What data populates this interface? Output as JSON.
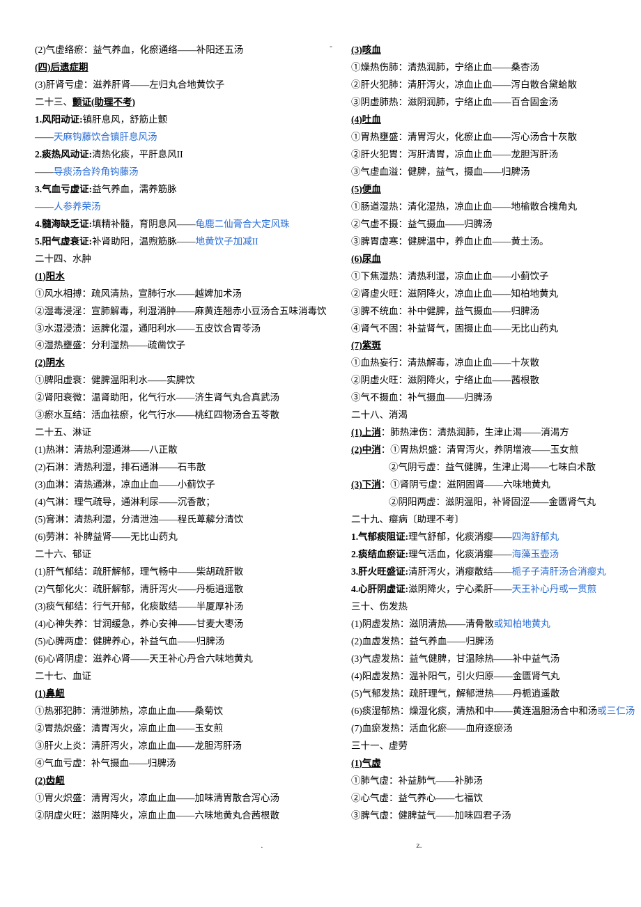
{
  "header_dash": "-",
  "footerL": ".",
  "footerR": "z.",
  "left": [
    [
      {
        "t": "(2)气虚络瘀：益气养血，化瘀通络——补阳还五汤"
      }
    ],
    [
      {
        "t": "(四)后遗症期",
        "cls": "b u"
      }
    ],
    [
      {
        "t": "(3)肝肾亏虚：滋养肝肾——左归丸合地黄饮子"
      }
    ],
    [
      {
        "t": "二十三、"
      },
      {
        "t": "颤证(助理不考)",
        "cls": "b u"
      }
    ],
    [
      {
        "t": "1.风阳动证:",
        "cls": "b"
      },
      {
        "t": "镇肝息风，舒筋止颤"
      }
    ],
    [
      {
        "t": "——"
      },
      {
        "t": "天麻钩藤饮合镇肝息风汤",
        "cls": "blue"
      }
    ],
    [
      {
        "t": "2.痰热风动证:",
        "cls": "b"
      },
      {
        "t": "清热化痰，平肝息风II"
      }
    ],
    [
      {
        "t": "——"
      },
      {
        "t": "导痰汤合羚角钩藤汤",
        "cls": "blue"
      }
    ],
    [
      {
        "t": "3.气血亏虚证:",
        "cls": "b"
      },
      {
        "t": "益气养血，濡养筋脉"
      }
    ],
    [
      {
        "t": "——"
      },
      {
        "t": "人参养荣汤",
        "cls": "blue"
      }
    ],
    [
      {
        "t": "4.髓海缺乏证:",
        "cls": "b"
      },
      {
        "t": "填精补髓，育阴息风——"
      },
      {
        "t": "龟鹿二仙膏合大定风珠",
        "cls": "blue"
      }
    ],
    [
      {
        "t": "5.阳气虚衰证:",
        "cls": "b"
      },
      {
        "t": "补肾助阳，温煦筋脉——"
      },
      {
        "t": "地黄饮子加减II",
        "cls": "blue"
      }
    ],
    [
      {
        "t": "二十四、水肿"
      }
    ],
    [
      {
        "t": "(1)阳水",
        "cls": "b u"
      }
    ],
    [
      {
        "t": "①风水相搏：疏风清热，宣肺行水——越婢加术汤"
      }
    ],
    [
      {
        "t": "②湿毒浸淫：宣肺解毒，利湿消肿——麻黄连翘赤小豆汤合五味消毒饮"
      }
    ],
    [
      {
        "t": "③水湿浸渍：运脾化湿，通阳利水——五皮饮合胃苓汤"
      }
    ],
    [
      {
        "t": "④湿热壅盛：分利湿热——疏凿饮子"
      }
    ],
    [
      {
        "t": "(2)阴水",
        "cls": "b u"
      }
    ],
    [
      {
        "t": "①脾阳虚衰：健脾温阳利水——实脾饮"
      }
    ],
    [
      {
        "t": "②肾阳衰微：温肾助阳，化气行水——济生肾气丸合真武汤"
      }
    ],
    [
      {
        "t": "③瘀水互结：活血祛瘀，化气行水——桃红四物汤合五苓散"
      }
    ],
    [
      {
        "t": "二十五、淋证"
      }
    ],
    [
      {
        "t": "(1)热淋：清热利湿通淋——八正散"
      }
    ],
    [
      {
        "t": "(2)石淋：清热利湿，排石通淋——石韦散"
      }
    ],
    [
      {
        "t": "(3)血淋：清热通淋，凉血止血——小蓟饮子"
      }
    ],
    [
      {
        "t": "(4)气淋：理气疏导，通淋利尿——沉香散；"
      }
    ],
    [
      {
        "t": "(5)膏淋：清热利湿，分清泄浊——程氏萆薢分清饮"
      }
    ],
    [
      {
        "t": "(6)劳淋：补脾益肾——无比山药丸"
      }
    ],
    [
      {
        "t": "二十六、郁证"
      }
    ],
    [
      {
        "t": "(1)肝气郁结：疏肝解郁，理气畅中——柴胡疏肝散"
      }
    ],
    [
      {
        "t": "(2)气郁化火：疏肝解郁，清肝泻火——丹栀逍遥散"
      }
    ],
    [
      {
        "t": "(3)痰气郁结：行气开郁，化痰散结——半厦厚补汤"
      }
    ],
    [
      {
        "t": "(4)心神失养：甘润缓急，养心安神——甘麦大枣汤"
      }
    ],
    [
      {
        "t": "(5)心脾两虚：健脾养心，补益气血——归脾汤"
      }
    ],
    [
      {
        "t": "(6)心肾阴虚：滋养心肾——天王补心丹合六味地黄丸"
      }
    ],
    [
      {
        "t": "二十七、血证"
      }
    ],
    [
      {
        "t": "(1)鼻衄",
        "cls": "b u"
      }
    ],
    [
      {
        "t": "①热邪犯肺：清泄肺热，凉血止血——桑菊饮"
      }
    ],
    [
      {
        "t": "②胃热炽盛：清胃泻火，凉血止血——玉女煎"
      }
    ],
    [
      {
        "t": "③肝火上炎：清肝泻火，凉血止血——龙胆泻肝汤"
      }
    ],
    [
      {
        "t": "④气血亏虚：补气摄血——归脾汤"
      }
    ],
    [
      {
        "t": "(2)齿衄",
        "cls": "b u"
      }
    ],
    [
      {
        "t": "①胃火炽盛：清胃泻火，凉血止血——加味清胃散合泻心汤"
      }
    ],
    [
      {
        "t": "②阴虚火旺：滋阴降火，凉血止血——六味地黄丸合茜根散"
      }
    ]
  ],
  "right": [
    [
      {
        "t": "(3)咳血",
        "cls": "b u"
      }
    ],
    [
      {
        "t": "①燥热伤肺：清热润肺，宁络止血——桑杏汤"
      }
    ],
    [
      {
        "t": "②肝火犯肺：清肝泻火，凉血止血——泻白散合黛蛤散"
      }
    ],
    [
      {
        "t": "③阴虚肺热：滋阴润肺，宁络止血——百合固金汤"
      }
    ],
    [
      {
        "t": "(4)吐血",
        "cls": "b u"
      }
    ],
    [
      {
        "t": "①胃热壅盛：清胃泻火，化瘀止血——泻心汤合十灰散"
      }
    ],
    [
      {
        "t": "②肝火犯胃：泻肝清胃，凉血止血——龙胆泻肝汤"
      }
    ],
    [
      {
        "t": "③气虚血溢：健脾，益气，摄血——归脾汤"
      }
    ],
    [
      {
        "t": "(5)便血",
        "cls": "b u"
      }
    ],
    [
      {
        "t": "①肠道湿热：清化湿热，凉血止血——地榆散合槐角丸"
      }
    ],
    [
      {
        "t": "②气虚不摄：益气摄血——归脾汤"
      }
    ],
    [
      {
        "t": "③脾胃虚寒：健脾温中，养血止血——黄土汤。"
      }
    ],
    [
      {
        "t": "(6)尿血",
        "cls": "b u"
      }
    ],
    [
      {
        "t": "①下焦湿热：清热利湿，凉血止血——小蓟饮子"
      }
    ],
    [
      {
        "t": "②肾虚火旺：滋阴降火，凉血止血——知柏地黄丸"
      }
    ],
    [
      {
        "t": "③脾不统血：补中健脾，益气摄血——归脾汤"
      }
    ],
    [
      {
        "t": "④肾气不固：补益肾气，固摄止血——无比山药丸"
      }
    ],
    [
      {
        "t": "(7)紫斑",
        "cls": "b u"
      }
    ],
    [
      {
        "t": "①血热妄行：清热解毒，凉血止血——十灰散"
      }
    ],
    [
      {
        "t": "②阴虚火旺：滋阴降火，宁络止血——茜根散"
      }
    ],
    [
      {
        "t": "③气不摄血：补气摄血——归脾汤"
      }
    ],
    [
      {
        "t": "二十八、消渴"
      }
    ],
    [
      {
        "t": "(1)上消",
        "cls": "b u"
      },
      {
        "t": "：肺热津伤：清热润肺，生津止渴——消渴方"
      }
    ],
    [
      {
        "t": "(2)中消",
        "cls": "b u"
      },
      {
        "t": "：①胃热炽盛：清胃泻火，养阴增液——玉女煎"
      }
    ],
    [
      {
        "t": "　　　　②气阴亏虚：益气健脾，生津止渴——七味白术散"
      }
    ],
    [
      {
        "t": "(3)下消",
        "cls": "b u"
      },
      {
        "t": "：①肾阴亏虚：滋阴固肾——六味地黄丸"
      }
    ],
    [
      {
        "t": "　　　　②阴阳两虚：滋阴温阳，补肾固涩——金匮肾气丸"
      }
    ],
    [
      {
        "t": "二十九、瘿病〔助理不考〕"
      }
    ],
    [
      {
        "t": "1.气郁痰阻证:",
        "cls": "b"
      },
      {
        "t": "理气舒郁，化痰消瘿——"
      },
      {
        "t": "四海舒郁丸",
        "cls": "blue"
      }
    ],
    [
      {
        "t": "2.痰结血瘀证:",
        "cls": "b"
      },
      {
        "t": "理气活血，化痰消瘿——"
      },
      {
        "t": "海藻玉壶汤",
        "cls": "blue"
      }
    ],
    [
      {
        "t": "3.肝火旺盛证:",
        "cls": "b"
      },
      {
        "t": "清肝泻火，消瘿散结——"
      },
      {
        "t": "栀子子清肝汤合消瘿丸",
        "cls": "blue"
      }
    ],
    [
      {
        "t": "4.心肝阴虚证:",
        "cls": "b"
      },
      {
        "t": "滋阴降火，宁心柔肝——"
      },
      {
        "t": "天王补心丹或一贯煎",
        "cls": "blue"
      }
    ],
    [
      {
        "t": "三十、伤发热"
      }
    ],
    [
      {
        "t": "(1)阴虚发热：滋阴清热——清骨散"
      },
      {
        "t": "或知柏地黄丸",
        "cls": "blue"
      }
    ],
    [
      {
        "t": "(2)血虚发热：益气养血——归脾汤"
      }
    ],
    [
      {
        "t": "(3)气虚发热：益气健脾，甘温除热——补中益气汤"
      }
    ],
    [
      {
        "t": "(4)阳虚发热：温补阳气，引火归原——金匮肾气丸"
      }
    ],
    [
      {
        "t": "(5)气郁发热：疏肝理气，解郁泄热——丹栀逍遥散"
      }
    ],
    [
      {
        "t": "(6)痰湿郁热：燥湿化痰，清热和中——黄连温胆汤合中和汤"
      },
      {
        "t": "或三仁汤",
        "cls": "blue"
      }
    ],
    [
      {
        "t": "(7)血瘀发热：活血化瘀——血府逐瘀汤"
      }
    ],
    [
      {
        "t": "三十一、虚劳"
      }
    ],
    [
      {
        "t": "(1)气虚",
        "cls": "b u"
      }
    ],
    [
      {
        "t": "①肺气虚：补益肺气——补肺汤"
      }
    ],
    [
      {
        "t": "②心气虚：益气养心——七福饮"
      }
    ],
    [
      {
        "t": "③脾气虚：健脾益气——加味四君子汤"
      }
    ]
  ]
}
